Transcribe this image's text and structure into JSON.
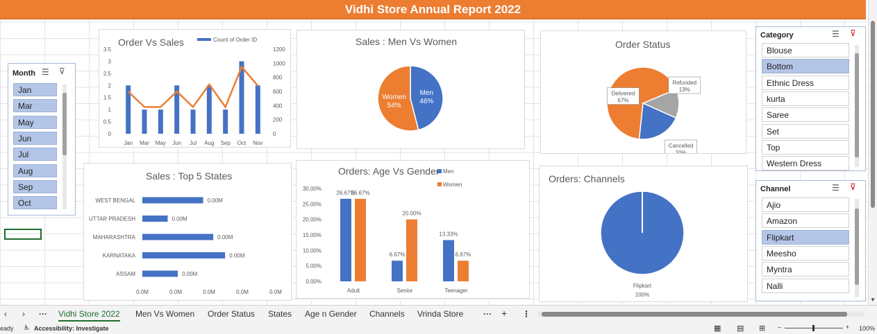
{
  "report_title": "Vidhi Store Annual Report 2022",
  "chart_data": [
    {
      "type": "bar",
      "title": "Order Vs Sales",
      "categories": [
        "Jan",
        "Mar",
        "May",
        "Jun",
        "Jul",
        "Aug",
        "Sep",
        "Oct",
        "Nov"
      ],
      "series": [
        {
          "name": "Count of Order ID",
          "values": [
            2,
            1,
            1,
            2,
            1,
            2,
            1,
            3,
            2
          ]
        },
        {
          "values": [
            600,
            380,
            380,
            600,
            380,
            700,
            380,
            950,
            680
          ]
        }
      ],
      "ylim": [
        0,
        3.5
      ],
      "y_ticks": [
        "0",
        "0.5",
        "1",
        "1.5",
        "2",
        "2.5",
        "3",
        "3.5"
      ],
      "y2lim": [
        0,
        1200
      ],
      "y2_ticks": [
        "0",
        "200",
        "400",
        "600",
        "800",
        "1000",
        "1200"
      ]
    },
    {
      "type": "pie",
      "title": "Sales : Men Vs Women",
      "labels": [
        "Men",
        "Women"
      ],
      "values": [
        46,
        54
      ],
      "value_labels": [
        "46%",
        "54%"
      ]
    },
    {
      "type": "pie",
      "title": "Order Status",
      "labels": [
        "Delivered",
        "Refunded",
        "Cancelled"
      ],
      "values": [
        67,
        13,
        20
      ],
      "value_labels": [
        "67%",
        "13%",
        "20%"
      ]
    },
    {
      "type": "bar",
      "title": "Sales : Top 5 States",
      "categories": [
        "WEST BENGAL",
        "UTTAR PRADESH",
        "MAHARASHTRA",
        "KARNATAKA",
        "ASSAM"
      ],
      "values": [
        0.0036,
        0.0015,
        0.0042,
        0.0049,
        0.0021
      ],
      "value_labels": [
        "0.00M",
        "0.00M",
        "0.00M",
        "0.00M",
        "0.00M"
      ],
      "x_ticks": [
        "0.0M",
        "0.0M",
        "0.0M",
        "0.0M",
        "0.0M"
      ]
    },
    {
      "type": "bar",
      "title": "Orders: Age Vs Gender",
      "categories": [
        "Adult",
        "Senior",
        "Teenager"
      ],
      "series": [
        {
          "name": "Men",
          "values": [
            26.67,
            6.67,
            13.33
          ]
        },
        {
          "name": "Women",
          "values": [
            26.67,
            20.0,
            6.67
          ]
        }
      ],
      "value_labels": [
        [
          "26.67%",
          "6.67%",
          "13.33%"
        ],
        [
          "26.67%",
          "20.00%",
          "6.67%"
        ]
      ],
      "ylim": [
        0,
        30
      ],
      "y_ticks": [
        "0.00%",
        "5.00%",
        "10.00%",
        "15.00%",
        "20.00%",
        "25.00%",
        "30.00%"
      ]
    },
    {
      "type": "pie",
      "title": "Orders: Channels",
      "labels": [
        "Flipkart"
      ],
      "values": [
        100
      ],
      "value_labels": [
        "100%"
      ]
    }
  ],
  "colors": {
    "blue": "#4472c4",
    "orange": "#ed7d31",
    "gray": "#a5a5a5"
  },
  "slicers": {
    "month": {
      "title": "Month",
      "items": [
        "Jan",
        "Mar",
        "May",
        "Jun",
        "Jul",
        "Aug",
        "Sep",
        "Oct"
      ]
    },
    "category": {
      "title": "Category",
      "items": [
        "Blouse",
        "Bottom",
        "Ethnic Dress",
        "kurta",
        "Saree",
        "Set",
        "Top",
        "Western Dress"
      ],
      "selected": "Bottom"
    },
    "channel": {
      "title": "Channel",
      "items": [
        "Ajio",
        "Amazon",
        "Flipkart",
        "Meesho",
        "Myntra",
        "Nalli"
      ],
      "selected": "Flipkart"
    }
  },
  "sheet_tabs": [
    "Vidhi Store 2022",
    "Men Vs Women",
    "Order Status",
    "States",
    "Age n Gender",
    "Channels",
    "Vrinda Store"
  ],
  "active_tab": "Vidhi Store 2022",
  "status_bar": {
    "ready": "eady",
    "accessibility": "Accessibility: Investigate",
    "zoom": "100%"
  }
}
